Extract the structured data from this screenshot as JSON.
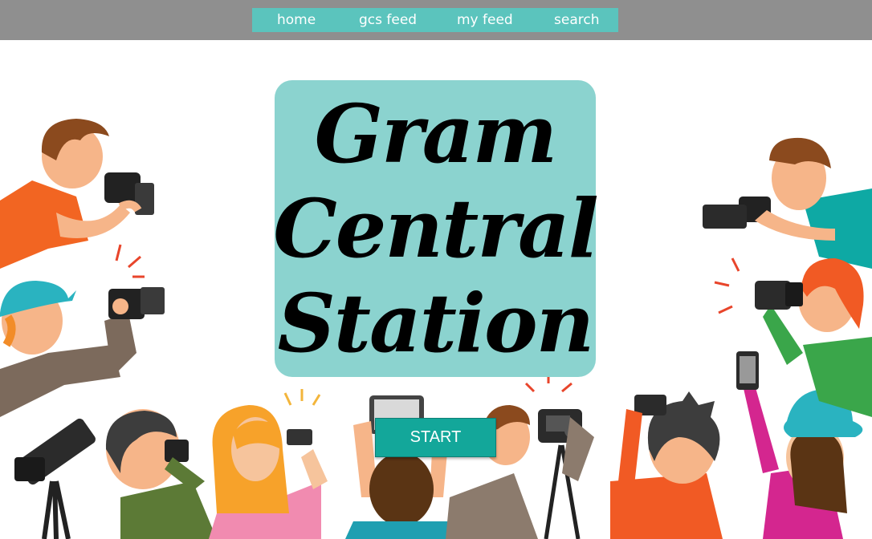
{
  "nav": {
    "items": [
      {
        "label": "home"
      },
      {
        "label": "gcs feed"
      },
      {
        "label": "my feed"
      },
      {
        "label": "search"
      }
    ]
  },
  "hero": {
    "title_lines": [
      "Gram",
      "Central",
      "Station"
    ],
    "start_label": "START"
  },
  "colors": {
    "topbar": "#8f8f8f",
    "nav_bg": "#5bc4bd",
    "title_card": "#8bd3cf",
    "start_button": "#13a79a"
  },
  "illustration": {
    "icon": "photographers-crowd-illustration"
  }
}
